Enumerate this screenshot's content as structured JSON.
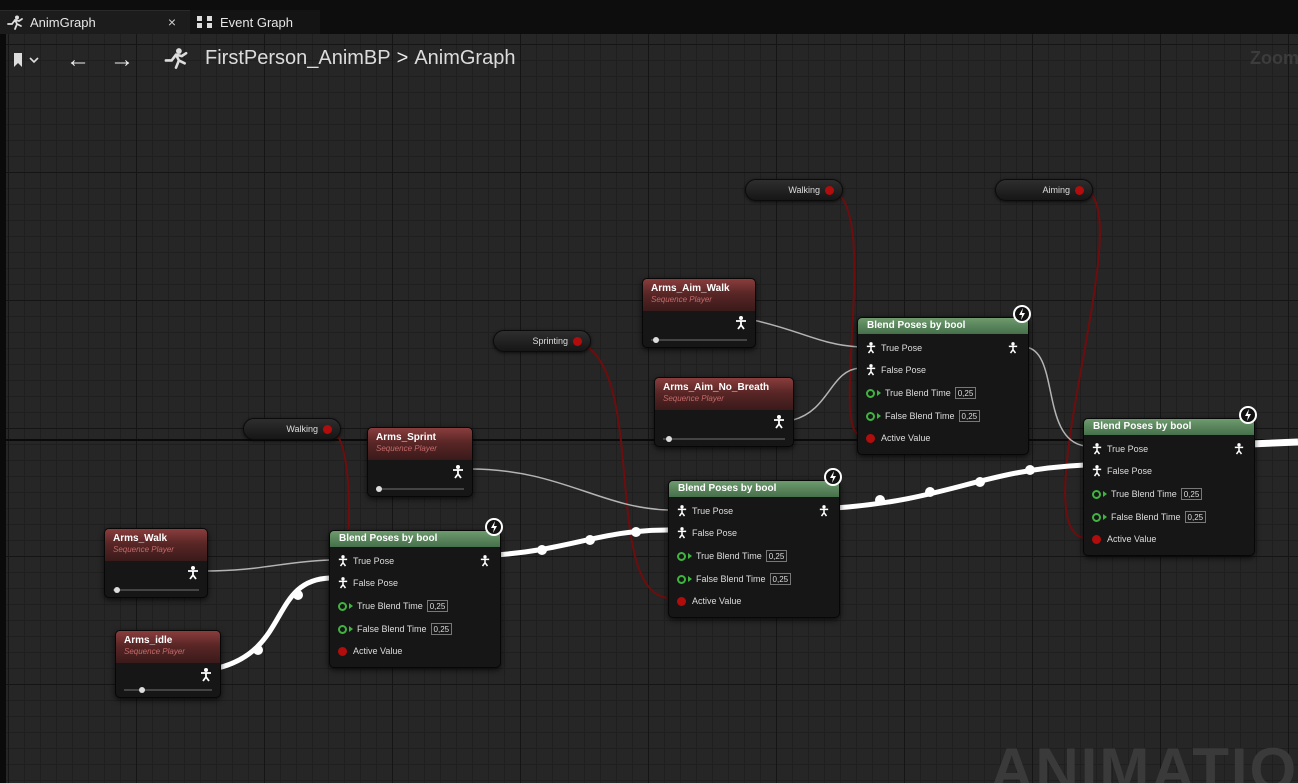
{
  "tabs": [
    {
      "label": "AnimGraph",
      "icon": "running-man-icon",
      "close": "×"
    },
    {
      "label": "Event Graph",
      "icon": "event-graph-icon"
    }
  ],
  "breadcrumb": {
    "asset": "FirstPerson_AnimBP",
    "separator": ">",
    "graph": "AnimGraph",
    "zoom": "Zoom"
  },
  "watermark": "ANIMATION",
  "getters": {
    "walking_1": "Walking",
    "sprinting": "Sprinting",
    "walking_2": "Walking",
    "aiming": "Aiming"
  },
  "sequence_players": {
    "arms_walk": {
      "title": "Arms_Walk",
      "subtitle": "Sequence Player",
      "progress": 0.05
    },
    "arms_idle": {
      "title": "Arms_idle",
      "subtitle": "Sequence Player",
      "progress": 0.2
    },
    "arms_sprint": {
      "title": "Arms_Sprint",
      "subtitle": "Sequence Player",
      "progress": 0.03
    },
    "arms_aim_walk": {
      "title": "Arms_Aim_Walk",
      "subtitle": "Sequence Player",
      "progress": 0.05
    },
    "arms_aim_no_breath": {
      "title": "Arms_Aim_No_Breath",
      "subtitle": "Sequence Player",
      "progress": 0.05
    }
  },
  "blend_nodes": {
    "blend_1": {
      "title": "Blend Poses by bool",
      "true_pose": "True Pose",
      "false_pose": "False Pose",
      "true_blend_time": "True Blend Time",
      "true_blend_value": "0,25",
      "false_blend_time": "False Blend Time",
      "false_blend_value": "0,25",
      "active_value": "Active Value"
    },
    "blend_2": {
      "title": "Blend Poses by bool",
      "true_pose": "True Pose",
      "false_pose": "False Pose",
      "true_blend_time": "True Blend Time",
      "true_blend_value": "0,25",
      "false_blend_time": "False Blend Time",
      "false_blend_value": "0,25",
      "active_value": "Active Value"
    },
    "blend_3": {
      "title": "Blend Poses by bool",
      "true_pose": "True Pose",
      "false_pose": "False Pose",
      "true_blend_time": "True Blend Time",
      "true_blend_value": "0,25",
      "false_blend_time": "False Blend Time",
      "false_blend_value": "0,25",
      "active_value": "Active Value"
    },
    "blend_4": {
      "title": "Blend Poses by bool",
      "true_pose": "True Pose",
      "false_pose": "False Pose",
      "true_blend_time": "True Blend Time",
      "true_blend_value": "0,25",
      "false_blend_time": "False Blend Time",
      "false_blend_value": "0,25",
      "active_value": "Active Value"
    }
  },
  "colors": {
    "graph_bg": "#262626",
    "bool_pin": "#b10d0d",
    "float_pin": "#3fb53f",
    "exec_wire": "#ffffff",
    "seq_header": "#7a3434",
    "blend_header": "#5a8a5e"
  }
}
